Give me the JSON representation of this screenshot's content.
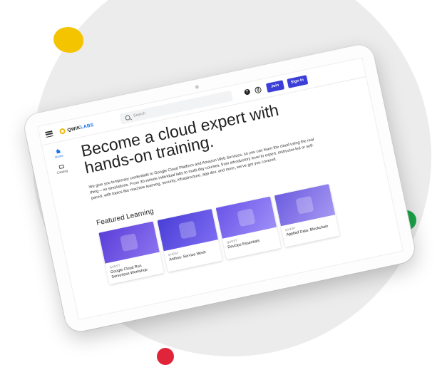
{
  "header": {
    "logo_prefix": "QWIK",
    "logo_suffix": "LABS",
    "search_placeholder": "Search",
    "join_label": "Join",
    "signin_label": "Sign in"
  },
  "sidebar": {
    "items": [
      {
        "label": "Home"
      },
      {
        "label": "Catalog"
      }
    ]
  },
  "hero": {
    "title": "Become a cloud expert with hands-on training.",
    "description": "We give you temporary credentials to Google Cloud Platform and Amazon Web Services, so you can learn the cloud using the real thing – no simulations. From 30-minute individual labs to multi-day courses, from introductory level to expert, instructor-led or self-paced, with topics like machine learning, security, infrastructure, app dev, and more, we've got you covered."
  },
  "featured": {
    "title": "Featured Learning",
    "cards": [
      {
        "type": "QUEST",
        "name": "Google Cloud Run Serverless Workshop"
      },
      {
        "type": "QUEST",
        "name": "Anthos: Service Mesh"
      },
      {
        "type": "QUEST",
        "name": "DevOps Essentials"
      },
      {
        "type": "QUEST",
        "name": "Applied Data: Blockchain"
      }
    ]
  },
  "colors": {
    "accent": "#3b3fd8",
    "yellow_dot": "#f4c400",
    "green_dot": "#1aa64a",
    "red_dot": "#e0253a"
  }
}
